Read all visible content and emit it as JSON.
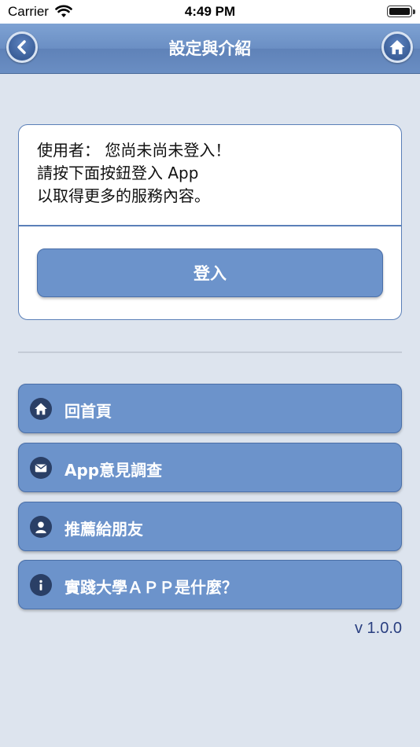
{
  "status_bar": {
    "carrier": "Carrier",
    "time": "4:49 PM"
  },
  "nav": {
    "title": "設定與介紹",
    "back_icon": "chevron-left-icon",
    "home_icon": "home-icon"
  },
  "login_card": {
    "message_lines": [
      "使用者： 您尚未尚未登入！",
      "請按下面按鈕登入 App",
      "以取得更多的服務內容。"
    ],
    "login_button": "登入"
  },
  "menu": {
    "items": [
      {
        "label": "回首頁",
        "icon": "home-icon"
      },
      {
        "label": "App意見調查",
        "icon": "mail-icon"
      },
      {
        "label": "推薦給朋友",
        "icon": "person-icon"
      },
      {
        "label": "實踐大學ＡＰＰ是什麼？",
        "icon": "info-icon"
      }
    ]
  },
  "version": "v 1.0.0",
  "colors": {
    "nav": "#6b8fc4",
    "button": "#6c93cb",
    "background": "#dde4ee"
  }
}
